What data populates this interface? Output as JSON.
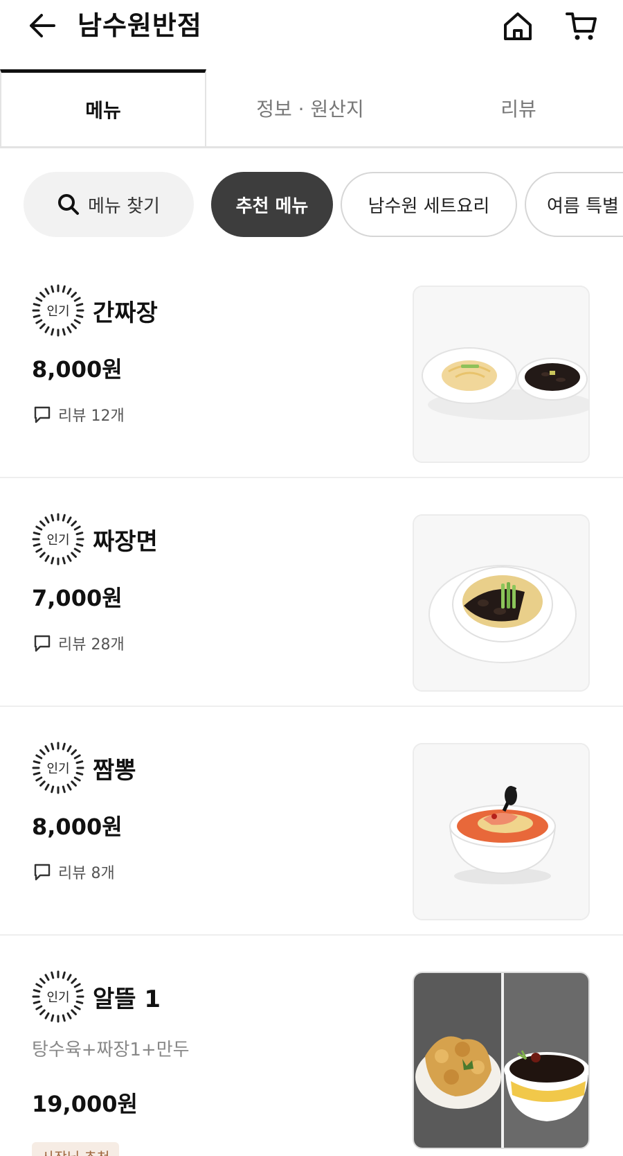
{
  "header": {
    "store_name": "남수원반점",
    "icons": {
      "back": "arrow-left-icon",
      "home": "home-icon",
      "cart": "cart-icon"
    }
  },
  "tabs": [
    {
      "label": "메뉴",
      "active": true
    },
    {
      "label": "정보 · 원산지",
      "active": false
    },
    {
      "label": "리뷰",
      "active": false
    }
  ],
  "categories": {
    "search_label": "메뉴 찾기",
    "chips": [
      {
        "label": "추천 메뉴",
        "active": true
      },
      {
        "label": "남수원 세트요리",
        "active": false
      },
      {
        "label": "여름 특별",
        "active": false
      }
    ]
  },
  "menu": [
    {
      "badge": "인기",
      "name": "간짜장",
      "price": "8,000원",
      "reviews": "리뷰 12개"
    },
    {
      "badge": "인기",
      "name": "짜장면",
      "price": "7,000원",
      "reviews": "리뷰 28개"
    },
    {
      "badge": "인기",
      "name": "짬뽕",
      "price": "8,000원",
      "reviews": "리뷰 8개"
    },
    {
      "badge": "인기",
      "name": "알뜰 1",
      "description": "탕수육+짜장1+만두",
      "price": "19,000원",
      "tag": "사장님 추천"
    }
  ],
  "colors": {
    "active_chip": "#3d3d3d",
    "tag_bg": "#f6ece4",
    "tag_text": "#a0673f"
  }
}
